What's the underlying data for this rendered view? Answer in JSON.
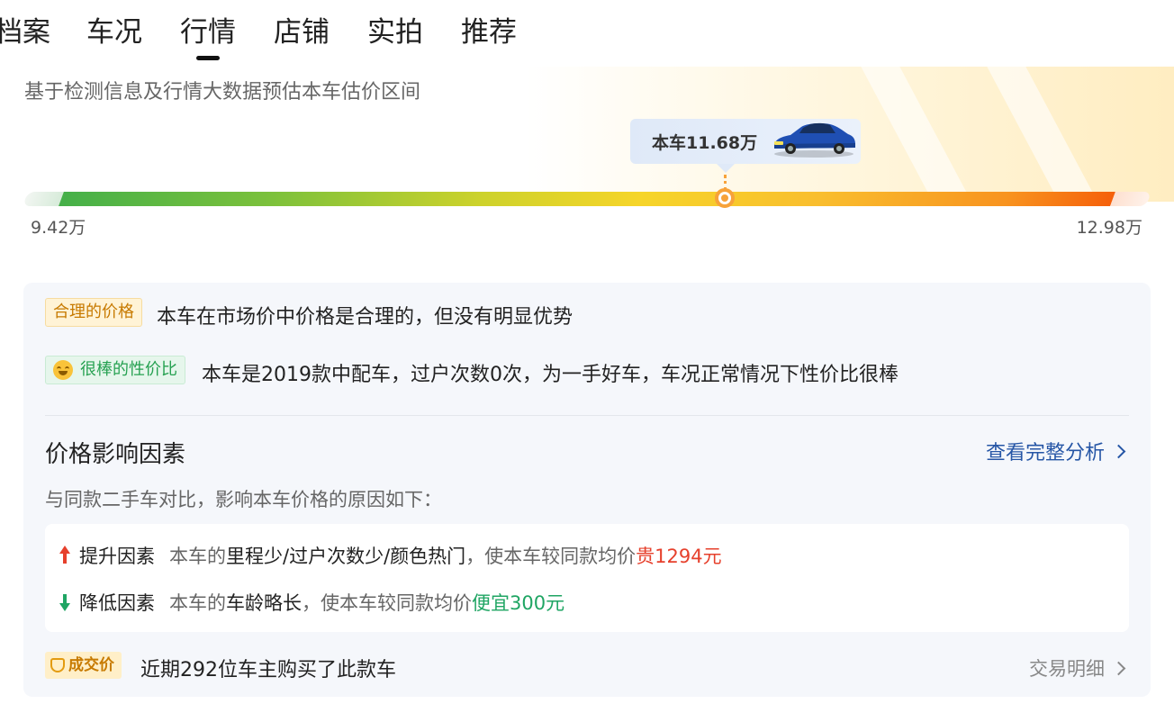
{
  "tabs": [
    {
      "label": "档案"
    },
    {
      "label": "车况"
    },
    {
      "label": "行情"
    },
    {
      "label": "店铺"
    },
    {
      "label": "实拍"
    },
    {
      "label": "推荐"
    }
  ],
  "active_tab": "行情",
  "estimate": {
    "subtitle": "基于检测信息及行情大数据预估本车估价区间",
    "current_price": "本车11.68万",
    "min_price": "9.42万",
    "max_price": "12.98万",
    "current_position_fraction": 0.63
  },
  "assessment": {
    "price_tag": "合理的价格",
    "price_text": "本车在市场价中价格是合理的，但没有明显优势",
    "value_tag": "很棒的性价比",
    "value_text": "本车是2019款中配车，过户次数0次，为一手好车，车况正常情况下性价比很棒"
  },
  "factors_section": {
    "title": "价格影响因素",
    "link": "查看完整分析",
    "desc": "与同款二手车对比，影响本车价格的原因如下：",
    "up": {
      "label": "提升因素",
      "prefix": "本车的",
      "highlight": "里程少/过户次数少/颜色热门",
      "middle": "，使本车较同款均价",
      "amount": "贵1294元"
    },
    "down": {
      "label": "降低因素",
      "prefix": "本车的",
      "highlight": "车龄略长",
      "middle": "，使本车较同款均价",
      "amount": "便宜300元"
    }
  },
  "deal": {
    "tag": "成交价",
    "text": "近期292位车主购买了此款车",
    "link": "交易明细"
  },
  "icons": [
    "car-image",
    "emoji-icon",
    "arrow-up-icon",
    "arrow-down-icon",
    "chevron-right-icon",
    "deal-icon"
  ],
  "colors": {
    "link_blue": "#2656a6",
    "up_red": "#e6402c",
    "down_green": "#1fa563",
    "tag_orange": "#c77a00",
    "marker_orange": "#f7a23a"
  }
}
